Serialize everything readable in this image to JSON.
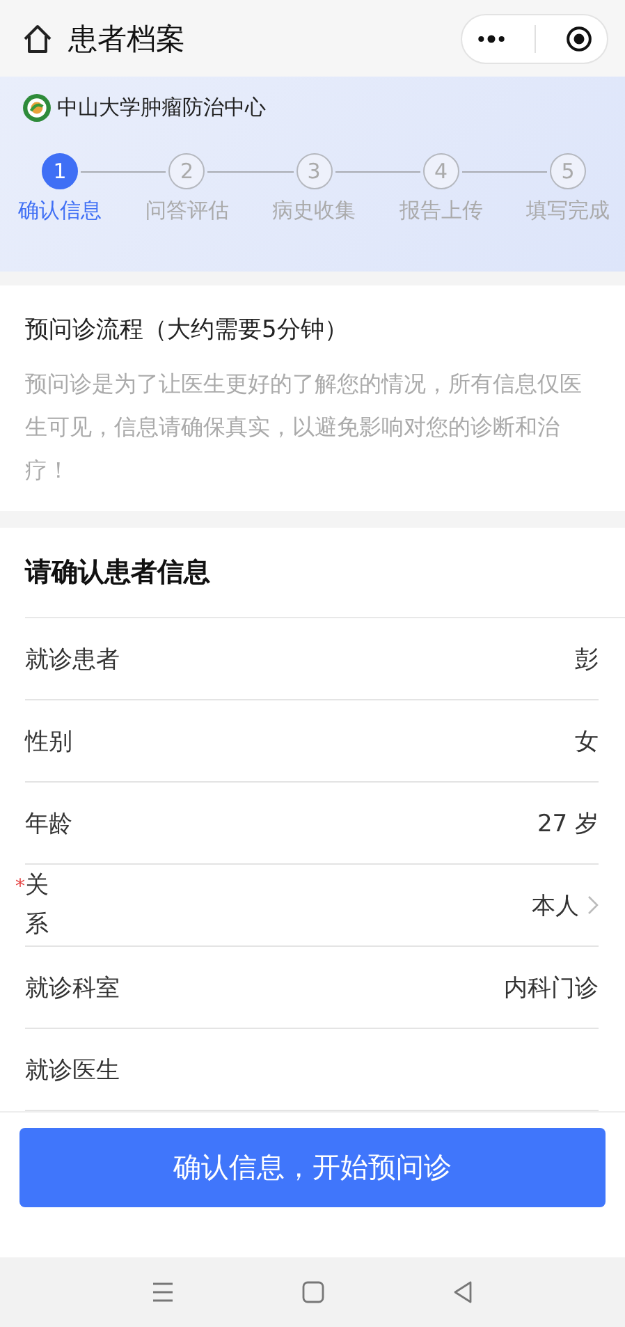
{
  "nav": {
    "title": "患者档案"
  },
  "hospital": {
    "name": "中山大学肿瘤防治中心"
  },
  "steps": [
    {
      "number": "1",
      "label": "确认信息",
      "selected": true
    },
    {
      "number": "2",
      "label": "问答评估",
      "selected": false
    },
    {
      "number": "3",
      "label": "病史收集",
      "selected": false
    },
    {
      "number": "4",
      "label": "报告上传",
      "selected": false
    },
    {
      "number": "5",
      "label": "填写完成",
      "selected": false
    }
  ],
  "intro": {
    "title": "预问诊流程（大约需要5分钟）",
    "text": "预问诊是为了让医生更好的了解您的情况，所有信息仅医生可见，信息请确保真实，以避免影响对您的诊断和治疗！"
  },
  "form": {
    "title": "请确认患者信息",
    "rows": [
      {
        "label": "就诊患者",
        "value": "彭",
        "kind": "text"
      },
      {
        "label": "性别",
        "value": "女",
        "kind": "text"
      },
      {
        "label": "年龄",
        "value": "27 岁",
        "kind": "text"
      },
      {
        "label": "关系",
        "value": "本人",
        "required_mark": "*",
        "kind": "select"
      },
      {
        "label": "就诊科室",
        "value": "内科门诊",
        "kind": "text"
      },
      {
        "label": "就诊医生",
        "kind": "text"
      }
    ]
  },
  "submit_button": "确认信息，开始预问诊"
}
